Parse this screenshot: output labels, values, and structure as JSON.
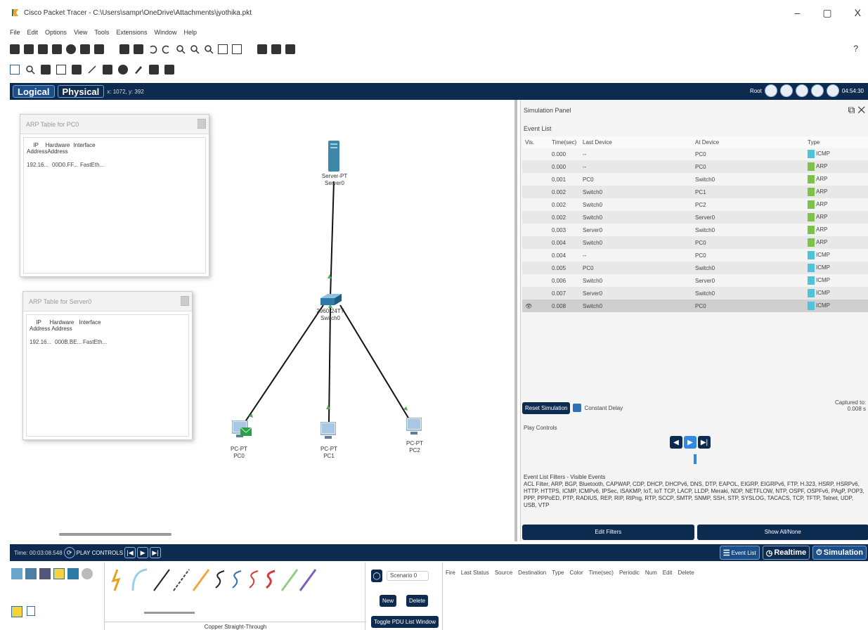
{
  "window": {
    "title": "Cisco Packet Tracer - C:\\Users\\sampr\\OneDrive\\Attachments\\jyothika.pkt",
    "controls": {
      "minimize": "–",
      "maximize": "▢",
      "close": "X"
    }
  },
  "menu": [
    "File",
    "Edit",
    "Options",
    "View",
    "Tools",
    "Extensions",
    "Window",
    "Help"
  ],
  "help": "?",
  "modes": {
    "logical": "Logical",
    "physical": "Physical",
    "coords": "x: 1072, y: 392",
    "root": "Root",
    "time": "04:54:30"
  },
  "arp_pc0": {
    "title": "ARP Table for PC0",
    "cols": [
      "IP Address",
      "Hardware Address",
      "Interface"
    ],
    "row": [
      "192.16...",
      "00D0.FF...",
      "FastEth..."
    ]
  },
  "arp_server0": {
    "title": "ARP Table for Server0",
    "cols": [
      "IP Address",
      "Hardware Address",
      "Interface"
    ],
    "row": [
      "192.16...",
      "000B.BE...",
      "FastEth..."
    ]
  },
  "devices": {
    "server": "Server-PT\nServer0",
    "switch": "2960-24TT\nSwitch0",
    "pc0": "PC-PT\nPC0",
    "pc1": "PC-PT\nPC1",
    "pc2": "PC-PT\nPC2"
  },
  "sim": {
    "title": "Simulation Panel",
    "event_list": "Event List",
    "headers": [
      "Vis.",
      "Time(sec)",
      "Last Device",
      "At Device",
      "Type"
    ],
    "events": [
      {
        "t": "0.000",
        "last": "--",
        "at": "PC0",
        "type": "ICMP",
        "color": "#4fc3d9"
      },
      {
        "t": "0.000",
        "last": "--",
        "at": "PC0",
        "type": "ARP",
        "color": "#7dc34a"
      },
      {
        "t": "0.001",
        "last": "PC0",
        "at": "Switch0",
        "type": "ARP",
        "color": "#7dc34a"
      },
      {
        "t": "0.002",
        "last": "Switch0",
        "at": "PC1",
        "type": "ARP",
        "color": "#7dc34a"
      },
      {
        "t": "0.002",
        "last": "Switch0",
        "at": "PC2",
        "type": "ARP",
        "color": "#7dc34a"
      },
      {
        "t": "0.002",
        "last": "Switch0",
        "at": "Server0",
        "type": "ARP",
        "color": "#7dc34a"
      },
      {
        "t": "0.003",
        "last": "Server0",
        "at": "Switch0",
        "type": "ARP",
        "color": "#7dc34a"
      },
      {
        "t": "0.004",
        "last": "Switch0",
        "at": "PC0",
        "type": "ARP",
        "color": "#7dc34a"
      },
      {
        "t": "0.004",
        "last": "--",
        "at": "PC0",
        "type": "ICMP",
        "color": "#4fc3d9"
      },
      {
        "t": "0.005",
        "last": "PC0",
        "at": "Switch0",
        "type": "ICMP",
        "color": "#4fc3d9"
      },
      {
        "t": "0.006",
        "last": "Switch0",
        "at": "Server0",
        "type": "ICMP",
        "color": "#4fc3d9"
      },
      {
        "t": "0.007",
        "last": "Server0",
        "at": "Switch0",
        "type": "ICMP",
        "color": "#4fc3d9"
      },
      {
        "t": "0.008",
        "last": "Switch0",
        "at": "PC0",
        "type": "ICMP",
        "color": "#4fc3d9"
      }
    ],
    "reset": "Reset Simulation",
    "constant_delay": "Constant Delay",
    "captured_label": "Captured to:",
    "captured_value": "0.008 s",
    "play_controls": "Play Controls",
    "filters_label": "Event List Filters - Visible Events",
    "filters_text": "ACL Filter, ARP, BGP, Bluetooth, CAPWAP, CDP, DHCP, DHCPv6, DNS, DTP, EAPOL, EIGRP, EIGRPv6, FTP, H.323, HSRP, HSRPv6, HTTP, HTTPS, ICMP, ICMPv6, IPSec, ISAKMP, IoT, IoT TCP, LACP, LLDP, Meraki, NDP, NETFLOW, NTP, OSPF, OSPFv6, PAgP, POP3, PPP, PPPoED, PTP, RADIUS, REP, RIP, RIPng, RTP, SCCP, SMTP, SNMP, SSH, STP, SYSLOG, TACACS, TCP, TFTP, Telnet, UDP, USB, VTP",
    "edit_filters": "Edit Filters",
    "show_all": "Show All/None"
  },
  "timebar": {
    "time": "Time: 00:03:08.548",
    "play": "PLAY CONTROLS",
    "event_list": "Event List",
    "realtime": "Realtime",
    "simulation": "Simulation"
  },
  "bottom": {
    "cable_name": "Copper Straight-Through",
    "scenario": "Scenario 0",
    "new": "New",
    "delete": "Delete",
    "toggle": "Toggle PDU List Window",
    "pdu_headers": [
      "Fire",
      "Last Status",
      "Source",
      "Destination",
      "Type",
      "Color",
      "Time(sec)",
      "Periodic",
      "Num",
      "Edit",
      "Delete"
    ]
  }
}
